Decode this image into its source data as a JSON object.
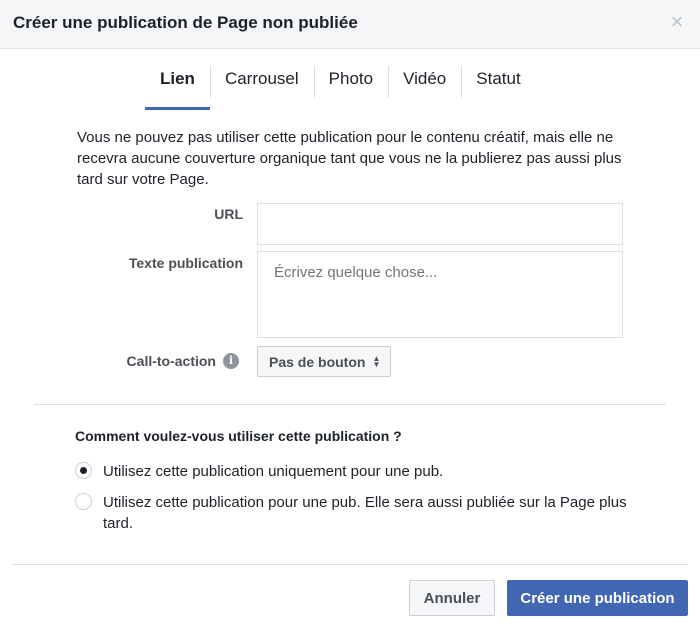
{
  "dialog": {
    "title": "Créer une publication de Page non publiée",
    "close_icon": "close-icon"
  },
  "tabs": [
    {
      "label": "Lien",
      "active": true
    },
    {
      "label": "Carrousel",
      "active": false
    },
    {
      "label": "Photo",
      "active": false
    },
    {
      "label": "Vidéo",
      "active": false
    },
    {
      "label": "Statut",
      "active": false
    }
  ],
  "notice": "Vous ne pouvez pas utiliser cette publication pour le contenu créatif, mais elle ne recevra aucune couverture organique tant que vous ne la publierez pas aussi plus tard sur votre Page.",
  "form": {
    "url_label": "URL",
    "url_value": "",
    "text_label": "Texte publication",
    "text_placeholder": "Écrivez quelque chose...",
    "cta_label": "Call-to-action",
    "cta_info_icon": "info-icon",
    "cta_value": "Pas de bouton"
  },
  "usage": {
    "question": "Comment voulez-vous utiliser cette publication ?",
    "options": [
      {
        "label": "Utilisez cette publication uniquement pour une pub.",
        "checked": true
      },
      {
        "label": "Utilisez cette publication pour une pub. Elle sera aussi publiée sur la Page plus tard.",
        "checked": false
      }
    ]
  },
  "footer": {
    "cancel_label": "Annuler",
    "submit_label": "Créer une publication"
  },
  "colors": {
    "accent": "#4267b2",
    "header_bg": "#f5f6f7",
    "border": "#dddfe2"
  }
}
